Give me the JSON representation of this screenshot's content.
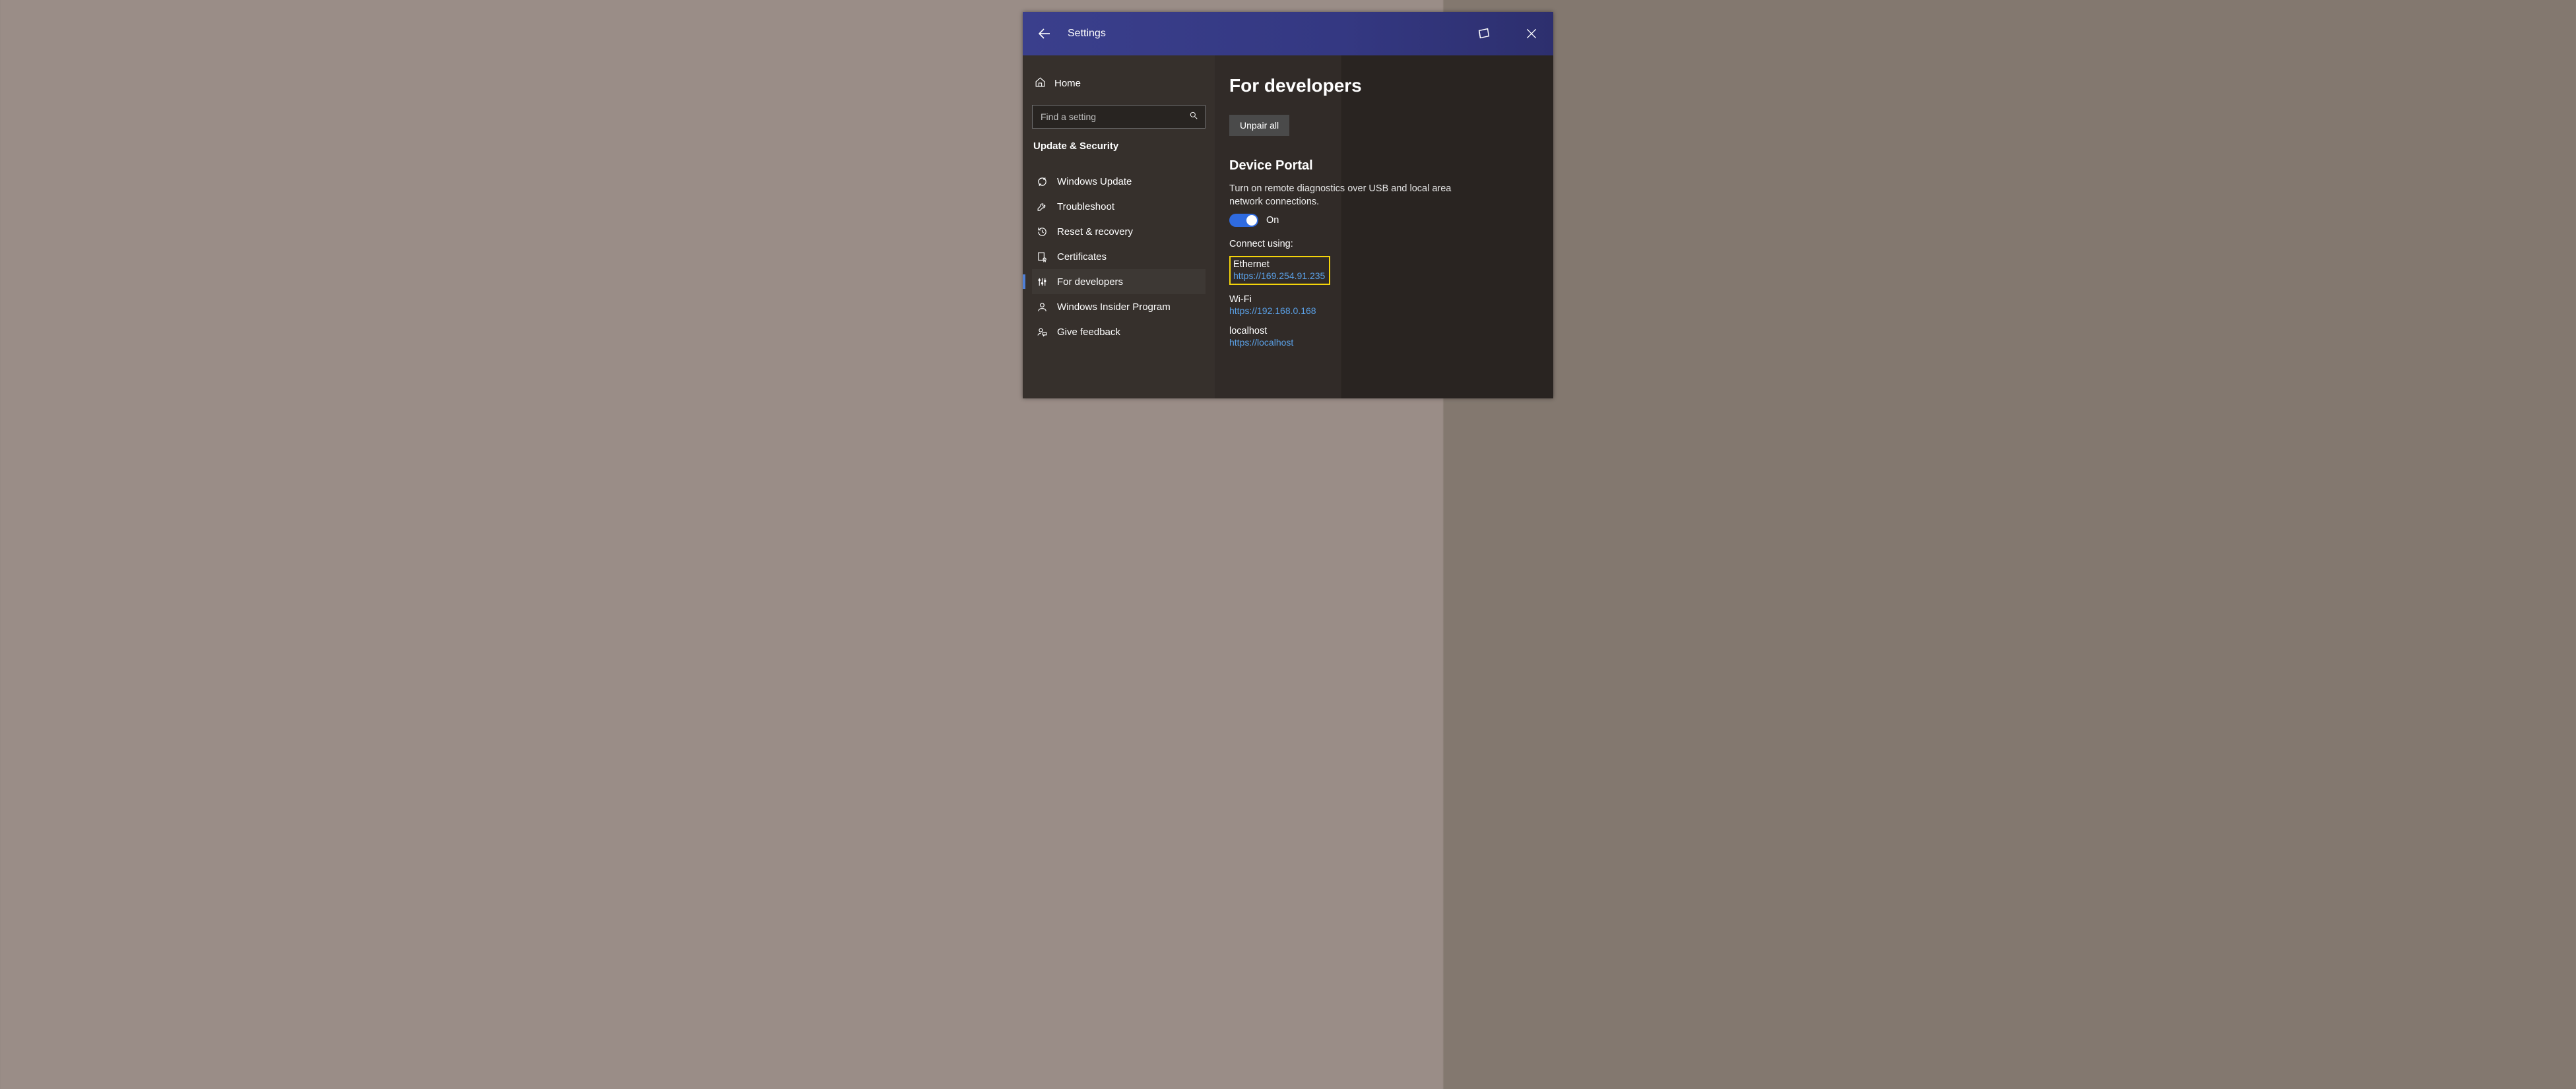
{
  "titlebar": {
    "title": "Settings"
  },
  "sidebar": {
    "home": "Home",
    "search_placeholder": "Find a setting",
    "section": "Update & Security",
    "items": [
      {
        "label": "Windows Update"
      },
      {
        "label": "Troubleshoot"
      },
      {
        "label": "Reset & recovery"
      },
      {
        "label": "Certificates"
      },
      {
        "label": "For developers"
      },
      {
        "label": "Windows Insider Program"
      },
      {
        "label": "Give feedback"
      }
    ]
  },
  "content": {
    "heading": "For developers",
    "unpair": "Unpair all",
    "dp_heading": "Device Portal",
    "dp_desc": "Turn on remote diagnostics over USB and local area network connections.",
    "toggle_state": "On",
    "connect_label": "Connect using:",
    "connections": [
      {
        "name": "Ethernet",
        "url": "https://169.254.91.235"
      },
      {
        "name": "Wi-Fi",
        "url": "https://192.168.0.168"
      },
      {
        "name": "localhost",
        "url": "https://localhost"
      }
    ]
  }
}
